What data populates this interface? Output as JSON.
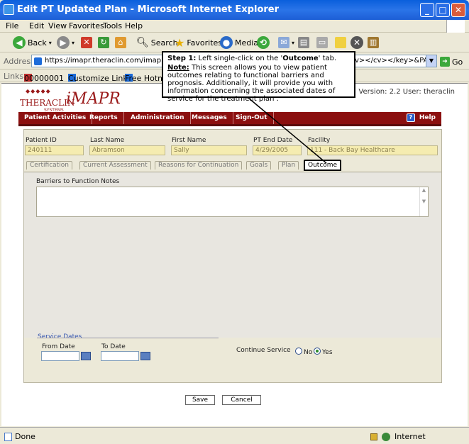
{
  "window": {
    "title": "Edit PT Updated Plan - Microsoft Internet Explorer"
  },
  "menu": [
    "File",
    "Edit",
    "View",
    "Favorites",
    "Tools",
    "Help"
  ],
  "toolbar": {
    "back": "Back",
    "search": "Search",
    "favorites": "Favorites",
    "media": "Media"
  },
  "address": {
    "label": "Address",
    "url": "https://imapr.theraclin.com/imaprtest/PT701",
    "url_tail": "v></cv></key>&PATIENT",
    "go": "Go"
  },
  "links": {
    "label": "Links",
    "items": [
      "00000001",
      "Customize Links",
      "Free Hotm"
    ]
  },
  "app": {
    "logo_brand": "THERACLIN",
    "logo_sub": "SYSTEMS",
    "logo_product": "iMAPR",
    "version_info": "Version: 2.2 User: theraclin"
  },
  "nav": {
    "items": [
      "Patient Activities",
      "Reports",
      "Administration",
      "Messages",
      "Sign-Out"
    ],
    "help": "Help"
  },
  "patient": {
    "labels": {
      "id": "Patient ID",
      "last": "Last Name",
      "first": "First Name",
      "end": "PT End Date",
      "facility": "Facility"
    },
    "values": {
      "id": "240111",
      "last": "Abramson",
      "first": "Sally",
      "end": "4/29/2005",
      "facility": "111 - Back Bay Healthcare"
    }
  },
  "tabs": [
    "Certification",
    "Current Assessment",
    "Reasons for Continuation",
    "Goals",
    "Plan",
    "Outcome"
  ],
  "active_tab": "Outcome",
  "outcome": {
    "barriers_label": "Barriers to Function Notes",
    "barriers_value": "",
    "service_dates_label": "Service Dates",
    "from_label": "From Date",
    "to_label": "To Date",
    "continue_label": "Continue Service",
    "no_label": "No",
    "yes_label": "Yes",
    "selected": "Yes"
  },
  "buttons": {
    "save": "Save",
    "cancel": "Cancel"
  },
  "callout": {
    "step": "Step 1:",
    "step_text": " Left single-click on the '",
    "step_target": "Outcome",
    "step_end": "' tab.",
    "note_label": "Note:",
    "note_text": " This screen allows you to view patient outcomes relating to functional barriers and prognosis. Additionally, it will provide you with information concerning the associated dates of service for the treatment plan ."
  },
  "status": {
    "left": "Done",
    "zone": "Internet"
  },
  "colors": {
    "nav": "#8b0f0f",
    "brand": "#9b1b1b",
    "field": "#f5ecb0"
  }
}
